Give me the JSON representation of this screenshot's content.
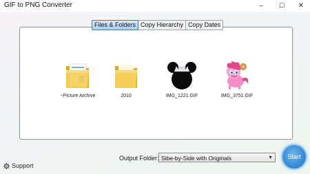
{
  "window": {
    "title": "GIF to PNG Converter",
    "minimize": "–",
    "maximize": "☐",
    "close": "✕"
  },
  "tabs": [
    {
      "label": "Files & Folders",
      "active": true
    },
    {
      "label": "Copy Hierarchy",
      "active": false
    },
    {
      "label": "Copy Dates",
      "active": false
    }
  ],
  "files": [
    {
      "label": "~Picture Archive",
      "icon": "folder-with-documents-icon"
    },
    {
      "label": "2010",
      "icon": "folder-icon"
    },
    {
      "label": "IMG_1221.GIF",
      "icon": "mouse-ears-tiara-icon"
    },
    {
      "label": "IMG_3751.GIF",
      "icon": "pink-pony-cartoon-icon"
    }
  ],
  "footer": {
    "support_label": "Support",
    "output_folder_label": "Output Folder:",
    "output_folder_value": "Sibe-by-Side with Originals",
    "start_label": "Start"
  },
  "colors": {
    "accent": "#3a8fd8",
    "tab_active": "#a9d0f2",
    "folder": "#f2c84b"
  }
}
